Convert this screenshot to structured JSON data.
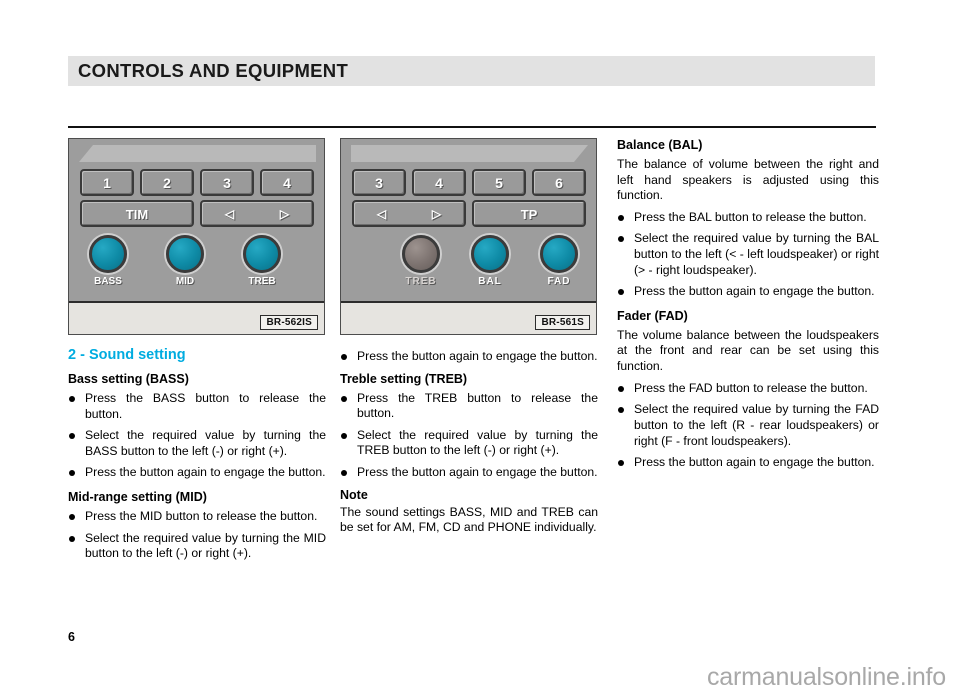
{
  "header": {
    "title": "CONTROLS AND EQUIPMENT"
  },
  "figures": [
    {
      "code": "BR-562IS",
      "presets": [
        "1",
        "2",
        "3",
        "4"
      ],
      "function_buttons": [
        "TIM",
        "◁  ▷"
      ],
      "left_button_label": "TIM",
      "arrow_left": "◁",
      "arrow_right": "▷",
      "knobs": [
        {
          "label": "BASS",
          "color": "#0e8aa5",
          "state": "teal"
        },
        {
          "label": "MID",
          "color": "#0e8aa5",
          "state": "teal"
        },
        {
          "label": "TREB",
          "color": "#0e8aa5",
          "state": "teal"
        }
      ]
    },
    {
      "code": "BR-561S",
      "presets": [
        "3",
        "4",
        "5",
        "6"
      ],
      "right_button_label": "TP",
      "arrow_left": "◁",
      "arrow_right": "▷",
      "knobs": [
        {
          "label": "TREB",
          "color": "#7d7370",
          "state": "grey"
        },
        {
          "label": "BAL",
          "color": "#0e8aa5",
          "state": "teal"
        },
        {
          "label": "FAD",
          "color": "#0e8aa5",
          "state": "teal"
        }
      ]
    }
  ],
  "column1": {
    "section_heading": "2 - Sound setting",
    "bass": {
      "heading": "Bass setting (BASS)",
      "bullets": [
        "Press the BASS button to release the button.",
        "Select the required value by turning the BASS button to the left (-) or right (+).",
        "Press the button again to engage the button."
      ]
    },
    "mid": {
      "heading": "Mid-range setting (MID)",
      "bullets": [
        "Press the MID button to release the button.",
        "Select the required value by turning the MID button to the left (-) or right (+)."
      ]
    }
  },
  "column2": {
    "carryover_bullet": "Press the button again to engage the button.",
    "treble": {
      "heading": "Treble setting (TREB)",
      "bullets": [
        "Press the TREB button to release the button.",
        "Select the required value by turning the TREB button to the left (-) or right (+).",
        "Press the button again to engage the button."
      ]
    },
    "note": {
      "heading": "Note",
      "text": "The sound settings BASS, MID and TREB can be set for AM, FM, CD and PHONE individually."
    }
  },
  "column3": {
    "balance": {
      "heading": "Balance (BAL)",
      "intro": "The balance of volume between the right and left hand speakers is adjusted using this function.",
      "bullets": [
        "Press the BAL button to release the button.",
        "Select the required value by turning the BAL button to the left (< - left loudspeaker) or right (> - right loudspeaker).",
        "Press the button again to engage the button."
      ]
    },
    "fader": {
      "heading": "Fader (FAD)",
      "intro": "The volume balance between the loudspeakers at the front and rear can be set using this function.",
      "bullets": [
        "Press the FAD button to release the button.",
        "Select the required value by turning the FAD button to the left (R - rear loudspeakers) or right (F - front loudspeakers).",
        "Press the button again to engage the button."
      ]
    }
  },
  "footer": {
    "page_number": "6",
    "watermark": "carmanualsonline.info"
  },
  "colors": {
    "accent_heading": "#00ace0",
    "header_band": "#e2e2e2",
    "knob_teal": "#0e8aa5",
    "knob_grey": "#7d7370"
  }
}
